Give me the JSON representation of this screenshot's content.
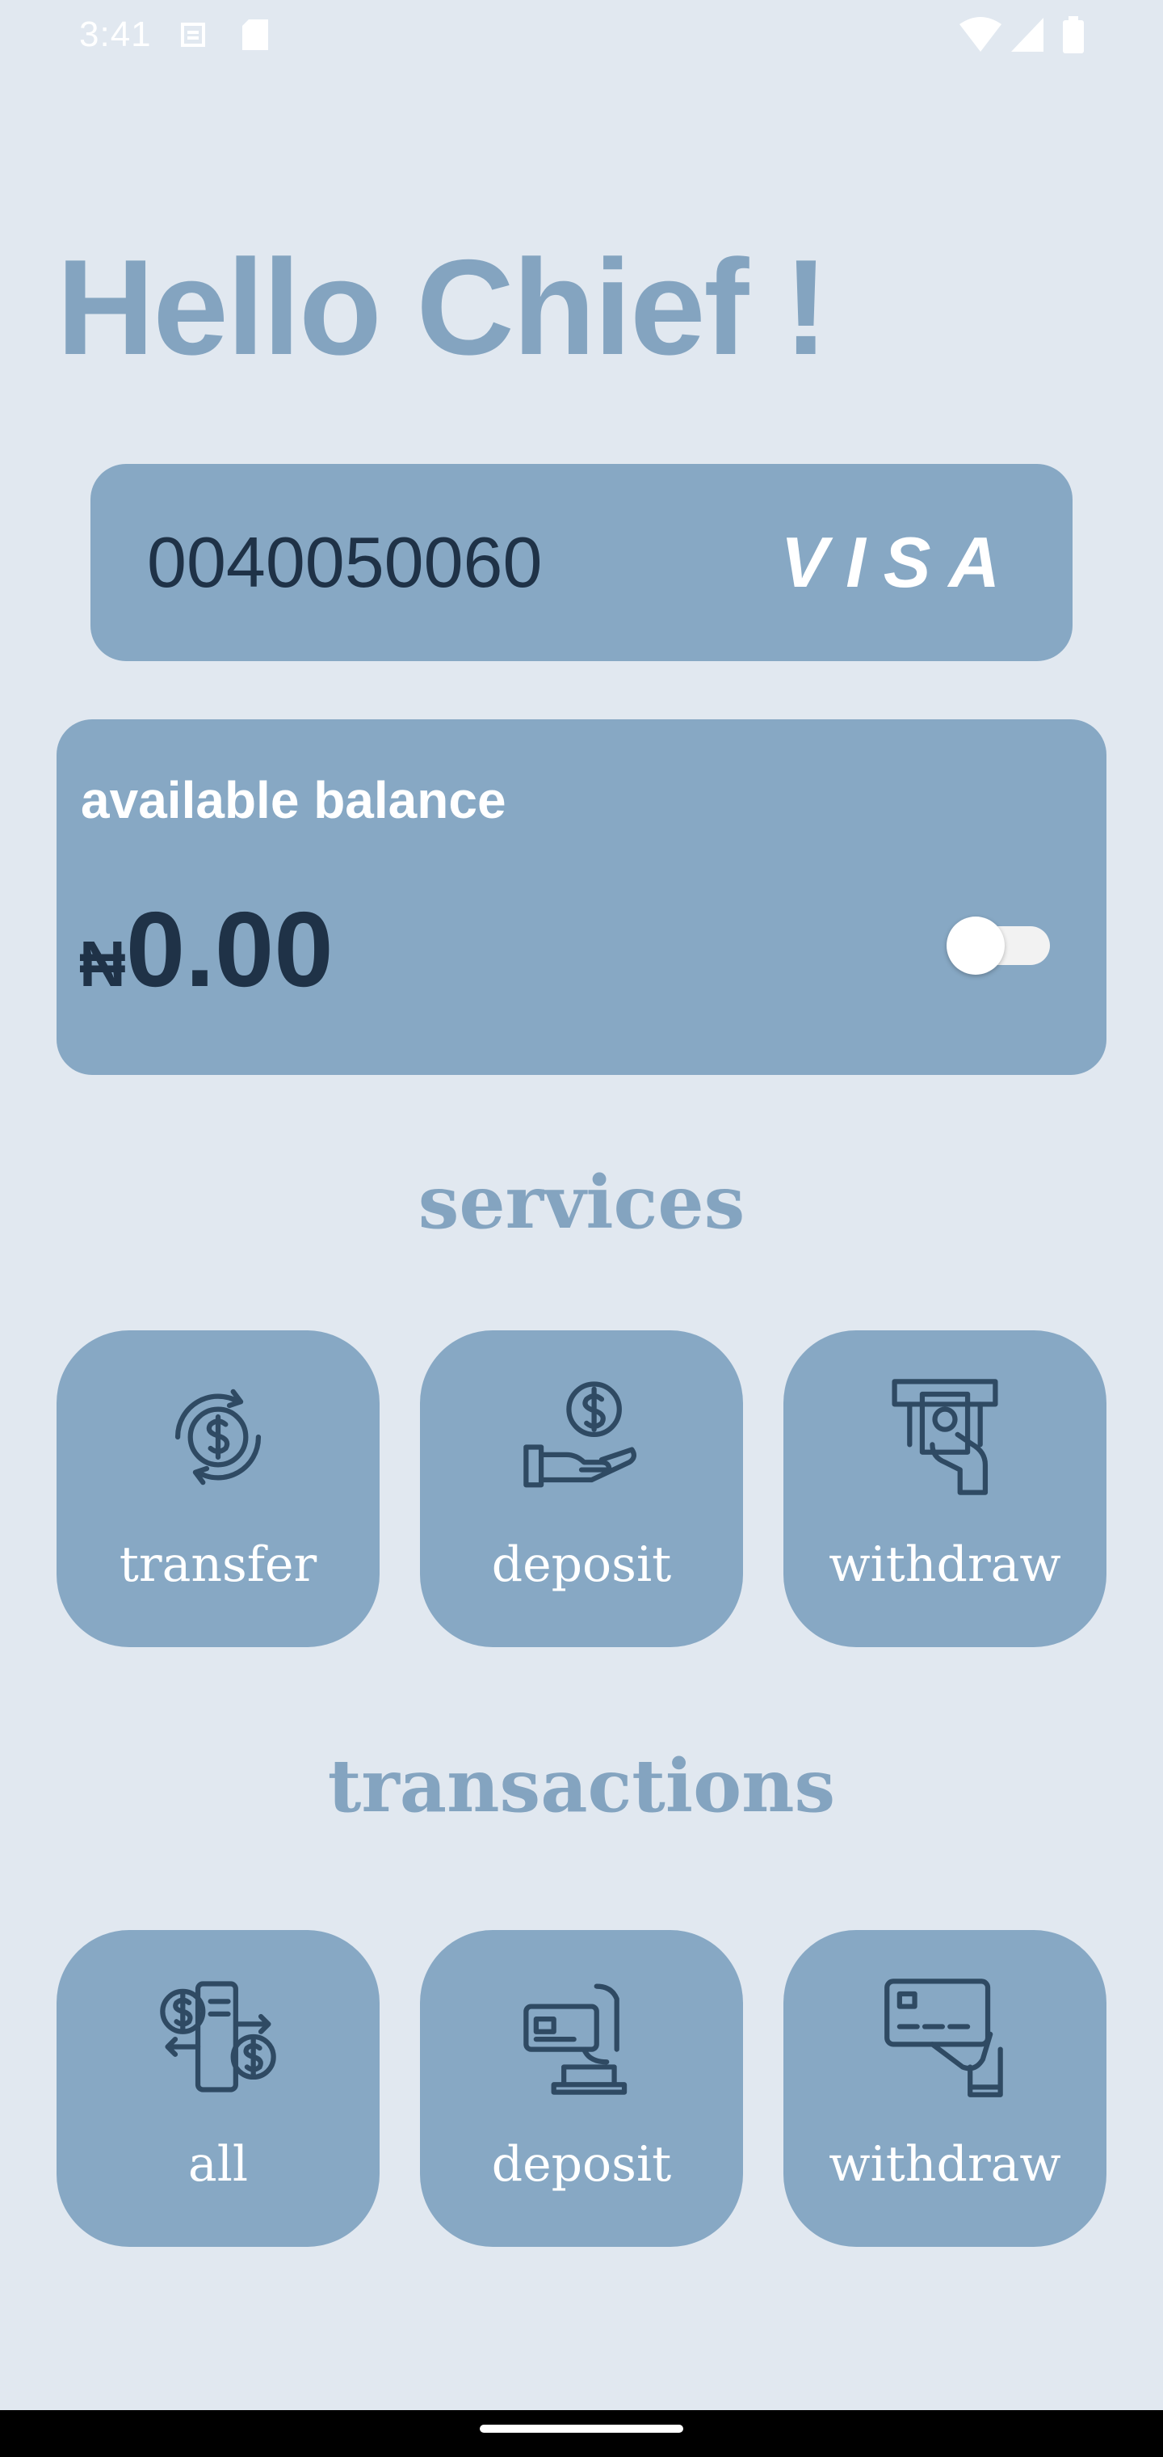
{
  "status_bar": {
    "time": "3:41",
    "left_icons": [
      "sync-icon",
      "sd-card-icon"
    ],
    "right_icons": [
      "wifi-icon",
      "signal-icon",
      "battery-icon"
    ]
  },
  "greeting": "Hello Chief !",
  "account_card": {
    "number": "0040050060",
    "brand": "VISA"
  },
  "balance": {
    "label": "available balance",
    "currency": "₦",
    "amount": "0.00",
    "visibility_toggle": "off"
  },
  "services": {
    "title": "services",
    "items": [
      {
        "label": "transfer",
        "icon": "money-transfer-icon"
      },
      {
        "label": "deposit",
        "icon": "hand-coin-icon"
      },
      {
        "label": "withdraw",
        "icon": "atm-withdraw-icon"
      }
    ]
  },
  "transactions": {
    "title": "transactions",
    "items": [
      {
        "label": "all",
        "icon": "money-exchange-icon"
      },
      {
        "label": "deposit",
        "icon": "card-deposit-icon"
      },
      {
        "label": "withdraw",
        "icon": "card-withdraw-icon"
      }
    ]
  },
  "colors": {
    "background": "#e1e8f0",
    "card": "#87a8c4",
    "accent_text": "#84a4c0",
    "dark_text": "#1f3247",
    "icon_stroke": "#2f4a63"
  }
}
